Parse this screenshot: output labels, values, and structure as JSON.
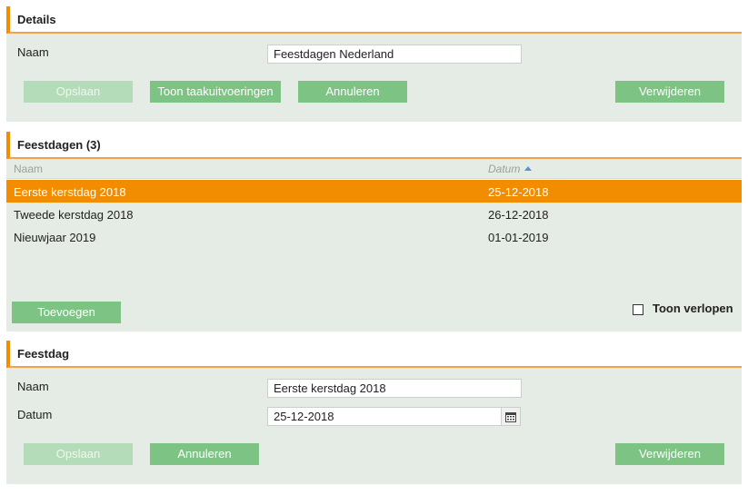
{
  "details": {
    "title": "Details",
    "name_label": "Naam",
    "name_value": "Feestdagen Nederland",
    "buttons": {
      "save": "Opslaan",
      "show_tasks": "Toon taakuitvoeringen",
      "cancel": "Annuleren",
      "delete": "Verwijderen"
    }
  },
  "holidays": {
    "title": "Feestdagen (3)",
    "columns": {
      "name": "Naam",
      "date": "Datum"
    },
    "rows": [
      {
        "name": "Eerste kerstdag 2018",
        "date": "25-12-2018",
        "selected": true
      },
      {
        "name": "Tweede kerstdag 2018",
        "date": "26-12-2018",
        "selected": false
      },
      {
        "name": "Nieuwjaar 2019",
        "date": "01-01-2019",
        "selected": false
      }
    ],
    "add_button": "Toevoegen",
    "show_expired_label": "Toon verlopen",
    "show_expired_checked": false
  },
  "holiday": {
    "title": "Feestdag",
    "name_label": "Naam",
    "name_value": "Eerste kerstdag 2018",
    "date_label": "Datum",
    "date_value": "25-12-2018",
    "buttons": {
      "save": "Opslaan",
      "cancel": "Annuleren",
      "delete": "Verwijderen"
    }
  },
  "icons": {
    "sort": "sort-ascending-icon",
    "calendar": "calendar-icon",
    "checkbox": "checkbox-unchecked"
  },
  "colors": {
    "accent": "#f28c00",
    "button": "#7dc384",
    "panel": "#e5ebe5"
  }
}
